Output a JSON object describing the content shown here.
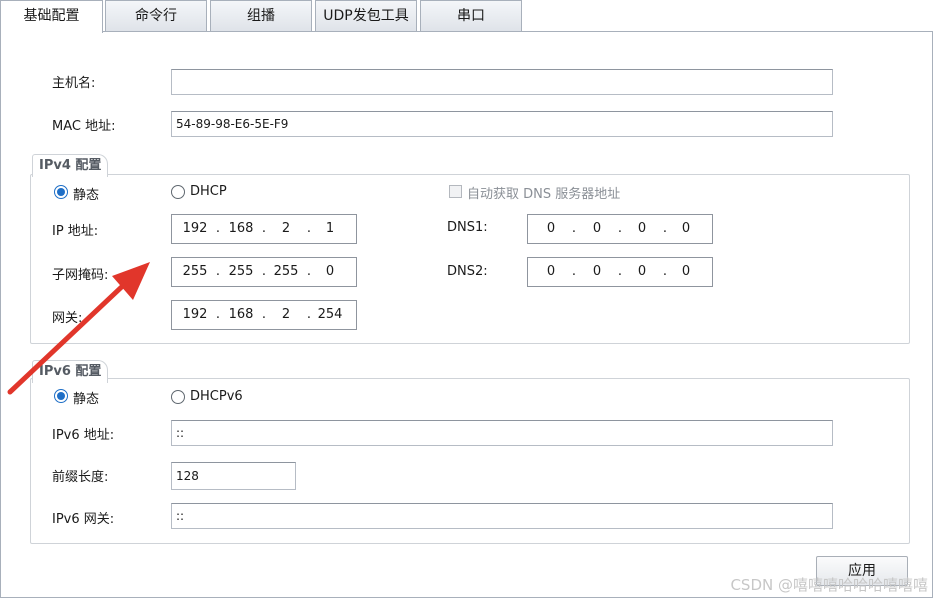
{
  "tabs": [
    {
      "label": "基础配置",
      "active": true
    },
    {
      "label": "命令行"
    },
    {
      "label": "组播"
    },
    {
      "label": "UDP发包工具"
    },
    {
      "label": "串口"
    }
  ],
  "host": {
    "hostname_label": "主机名:",
    "hostname_value": "",
    "mac_label": "MAC 地址:",
    "mac_value": "54-89-98-E6-5E-F9"
  },
  "ipv4": {
    "title": "IPv4 配置",
    "static_label": "静态",
    "dhcp_label": "DHCP",
    "auto_dns_label": "自动获取 DNS 服务器地址",
    "ip_label": "IP 地址:",
    "ip_value": [
      "192",
      "168",
      "2",
      "1"
    ],
    "mask_label": "子网掩码:",
    "mask_value": [
      "255",
      "255",
      "255",
      "0"
    ],
    "gateway_label": "网关:",
    "gateway_value": [
      "192",
      "168",
      "2",
      "254"
    ],
    "dns1_label": "DNS1:",
    "dns1_value": [
      "0",
      "0",
      "0",
      "0"
    ],
    "dns2_label": "DNS2:",
    "dns2_value": [
      "0",
      "0",
      "0",
      "0"
    ]
  },
  "ipv6": {
    "title": "IPv6 配置",
    "static_label": "静态",
    "dhcp_label": "DHCPv6",
    "address_label": "IPv6 地址:",
    "address_value": "::",
    "prefix_label": "前缀长度:",
    "prefix_value": "128",
    "gateway_label": "IPv6 网关:",
    "gateway_value": "::"
  },
  "apply_label": "应用",
  "watermark": "CSDN @嘻嘻嘻哈哈哈嘻嘻嘻",
  "colors": {
    "accent": "#1f6fc7",
    "arrow": "#e1362b"
  },
  "icons": [
    "radio-checked-icon",
    "radio-unchecked-icon",
    "checkbox-icon",
    "annotation-arrow-icon"
  ]
}
